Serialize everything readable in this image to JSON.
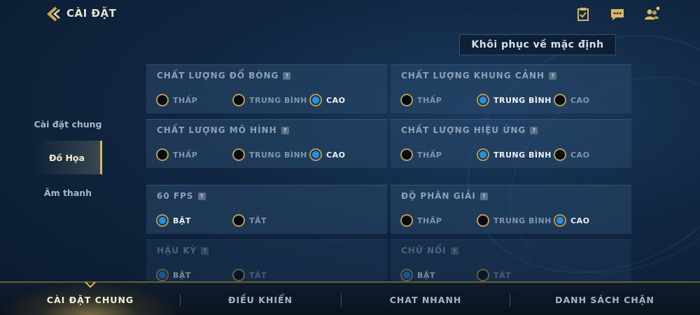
{
  "header": {
    "title": "CÀI ĐẶT",
    "icons": [
      "back-icon",
      "checklist-icon",
      "chat-icon",
      "friends-icon"
    ]
  },
  "reset_button": {
    "label": "Khôi phục về mặc định"
  },
  "nav": {
    "items": [
      {
        "label": "Cài đặt chung",
        "active": false
      },
      {
        "label": "Đồ Họa",
        "active": true
      },
      {
        "label": "Âm thanh",
        "active": false
      }
    ]
  },
  "panels": [
    {
      "title": "CHẤT LƯỢNG ĐỔ BÓNG",
      "options": [
        "THẤP",
        "TRUNG BÌNH",
        "CAO"
      ],
      "selected": 2
    },
    {
      "title": "CHẤT LƯỢNG KHUNG CẢNH",
      "options": [
        "THẤP",
        "TRUNG BÌNH",
        "CAO"
      ],
      "selected": 1
    },
    {
      "title": "CHẤT LƯỢNG MÔ HÌNH",
      "options": [
        "THẤP",
        "TRUNG BÌNH",
        "CAO"
      ],
      "selected": 2
    },
    {
      "title": "CHẤT LƯỢNG HIỆU ỨNG",
      "options": [
        "THẤP",
        "TRUNG BÌNH",
        "CAO"
      ],
      "selected": 1
    },
    {
      "title": "60 FPS",
      "options": [
        "BẬT",
        "TẮT"
      ],
      "selected": 0
    },
    {
      "title": "ĐỘ PHÂN GIẢI",
      "options": [
        "THẤP",
        "TRUNG BÌNH",
        "CAO"
      ],
      "selected": 2
    },
    {
      "title": "HẬU KỲ",
      "options": [
        "BẬT",
        "TẮT"
      ],
      "selected": 0
    },
    {
      "title": "CHỮ NỔI",
      "options": [
        "BẬT",
        "TẮT"
      ],
      "selected": 0
    }
  ],
  "help_glyph": "?",
  "bottom_tabs": [
    {
      "label": "CÀI ĐẶT CHUNG",
      "active": true
    },
    {
      "label": "ĐIỀU KHIỂN",
      "active": false
    },
    {
      "label": "CHAT NHANH",
      "active": false
    },
    {
      "label": "DANH SÁCH CHẶN",
      "active": false
    }
  ],
  "colors": {
    "accent_gold": "#d9b760",
    "radio_selected": "#2a8ee0",
    "panel_bg": "#2a486a",
    "background": "#102640"
  }
}
